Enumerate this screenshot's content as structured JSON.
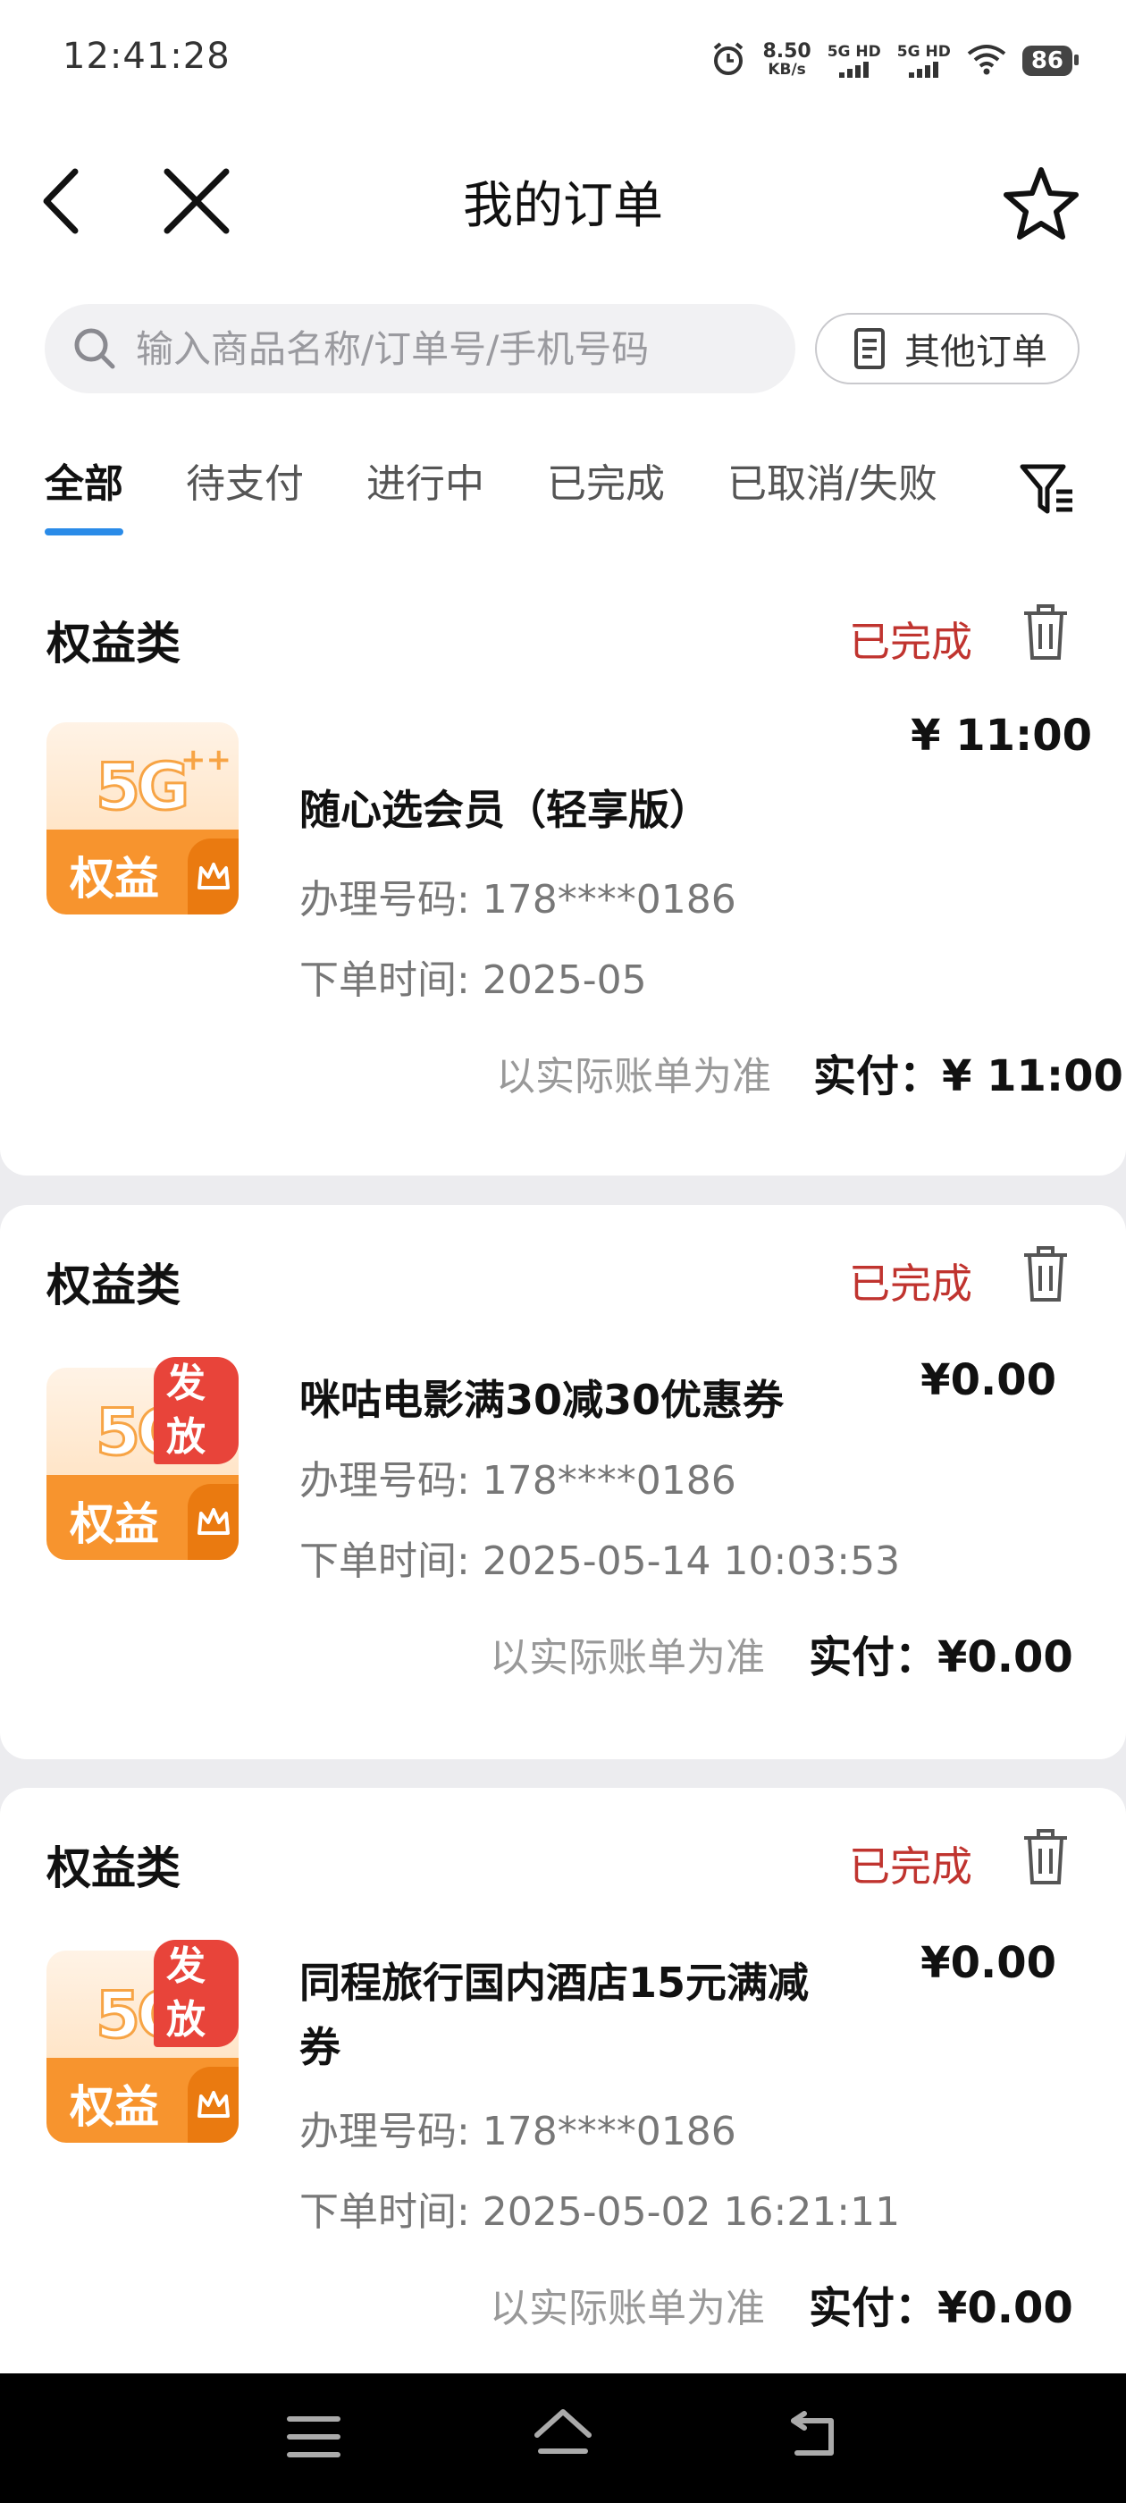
{
  "status_bar": {
    "time": "12:41:28",
    "net_speed_value": "8.50",
    "net_speed_unit": "KB/s",
    "sim1": "5G HD",
    "sim2": "5G HD",
    "battery": "86"
  },
  "nav": {
    "title": "我的订单"
  },
  "search": {
    "placeholder": "输入商品名称/订单号/手机号码",
    "value": ""
  },
  "other_orders_label": "其他订单",
  "tabs": [
    {
      "label": "全部",
      "active": true
    },
    {
      "label": "待支付",
      "active": false
    },
    {
      "label": "进行中",
      "active": false
    },
    {
      "label": "已完成",
      "active": false
    },
    {
      "label": "已取消/失败",
      "active": false
    }
  ],
  "thumb": {
    "label": "权益",
    "badge": "发放",
    "logo": "5G",
    "plus": "++"
  },
  "orders": [
    {
      "category": "权益类",
      "status": "已完成",
      "name": "随心选会员（轻享版）",
      "phone": "办理号码: 178****0186",
      "time": "下单时间: 2025-05",
      "price": "¥ 11:00",
      "bill_note": "以实际账单为准",
      "paid": "实付：¥ 11:00",
      "badge": false
    },
    {
      "category": "权益类",
      "status": "已完成",
      "name": "咪咕电影满30减30优惠券",
      "phone": "办理号码: 178****0186",
      "time": "下单时间: 2025-05-14 10:03:53",
      "price": "¥0.00",
      "bill_note": "以实际账单为准",
      "paid": "实付：¥0.00",
      "badge": true
    },
    {
      "category": "权益类",
      "status": "已完成",
      "name": "同程旅行国内酒店15元满减券",
      "phone": "办理号码: 178****0186",
      "time": "下单时间: 2025-05-02 16:21:11",
      "price": "¥0.00",
      "bill_note": "以实际账单为准",
      "paid": "实付：¥0.00",
      "badge": true
    }
  ],
  "colors": {
    "accent": "#2a8be8",
    "status": "#c0342f",
    "thumb_orange": "#f7942e",
    "badge_red": "#e8443a"
  }
}
